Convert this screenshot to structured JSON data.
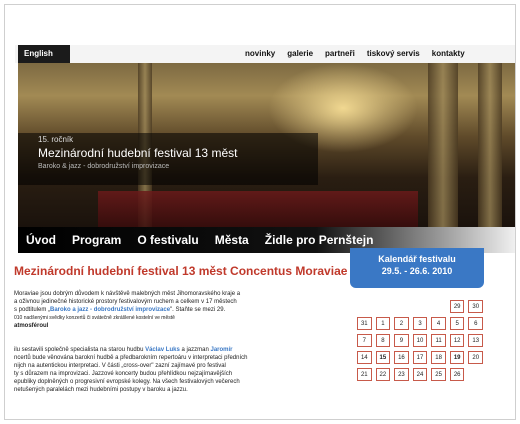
{
  "header": {
    "lang_label": "English",
    "nav": [
      "novinky",
      "galerie",
      "partneři",
      "tiskový servis",
      "kontakty"
    ]
  },
  "hero": {
    "edition": "15. ročník",
    "title": "Mezinárodní hudební festival 13 měst",
    "subtitle": "Baroko & jazz - dobrodružství improvizace"
  },
  "main_nav": [
    "Úvod",
    "Program",
    "O festivalu",
    "Města",
    "Židle pro Pernštejn"
  ],
  "calendar": {
    "title": "Kalendář festivalu",
    "dates": "29.5. - 26.6. 2010",
    "rows": [
      [
        "",
        "",
        "",
        "",
        "",
        "29",
        "30"
      ],
      [
        "31",
        "1",
        "2",
        "3",
        "4",
        "5",
        "6"
      ],
      [
        "7",
        "8",
        "9",
        "10",
        "11",
        "12",
        "13"
      ],
      [
        "14",
        "15",
        "16",
        "17",
        "18",
        "19",
        "20"
      ],
      [
        "21",
        "22",
        "23",
        "24",
        "25",
        "26",
        ""
      ]
    ]
  },
  "content": {
    "title": "Mezinárodní hudební festival 13 měst Concentus Moraviae",
    "p1_a": "Moraviae jsou dobrým důvodem k návštěvě malebných měst Jihomoravského kraje a",
    "p1_b": "a oživnou jedinečné historické prostory festivalovým ruchem a celkem v 17 městech",
    "p1_c_pre": "s podtitulem „",
    "p1_c_link": "Baroko a jazz - dobrodružství improvizace",
    "p1_c_post": "\". Staňte se mezi 29.",
    "p1_d": "010 nadšenými svědky konzertů či svátečně zkrášlené kostelní ve městě",
    "p1_e": "atmosféroul",
    "p2_a_pre": "ilu sestavili společně specialista na starou hudbu",
    "p2_a_link1": "Václav Luks",
    "p2_a_mid": "a jazzman",
    "p2_a_link2": "Jaromír",
    "p2_b": "ncertů bude věnována barokní hudbě a předbarokním repertoáru v interpretaci předních",
    "p2_c": "nijch na autentickou interpretaci. V části „cross-over\" zazní zajímavé pro festival",
    "p2_d": "ty s důrazem na improvizaci. Jazzové koncerty budou přehlídkou nejzajímavějších",
    "p2_e": "epubliky doplněných o progresivní evropské kolegy. Na všech festivalových večerech",
    "p2_f": "netušených paralelách mezi hudebními postupy v baroku a jazzu."
  }
}
